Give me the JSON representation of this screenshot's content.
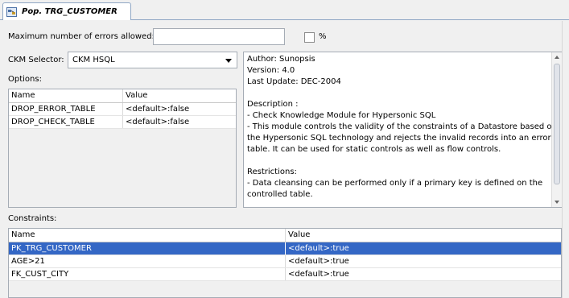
{
  "tab": {
    "title": "Pop. TRG_CUSTOMER"
  },
  "errors": {
    "label": "Maximum number of errors allowed:",
    "value": "",
    "percent_label": "%",
    "percent_checked": false
  },
  "ckm": {
    "label": "CKM Selector:",
    "selected": "CKM HSQL"
  },
  "options": {
    "label": "Options:",
    "columns": [
      "Name",
      "Value"
    ],
    "rows": [
      {
        "name": "DROP_ERROR_TABLE",
        "value": "<default>:false"
      },
      {
        "name": "DROP_CHECK_TABLE",
        "value": "<default>:false"
      }
    ]
  },
  "description": {
    "lines": [
      "Author: Sunopsis",
      "Version: 4.0",
      "Last Update: DEC-2004",
      "",
      "Description :",
      "- Check Knowledge Module for Hypersonic SQL",
      "- This module controls the validity of the constraints of a Datastore based on",
      "the Hypersonic SQL technology and rejects the invalid records into an error",
      "table. It can be used for static controls as well as flow controls.",
      "",
      "Restrictions:",
      "- Data cleansing can be performed only if a primary key is defined on the",
      "controlled table."
    ]
  },
  "constraints": {
    "label": "Constraints:",
    "columns": [
      "Name",
      "Value"
    ],
    "rows": [
      {
        "name": "PK_TRG_CUSTOMER",
        "value": "<default>:true",
        "selected": true
      },
      {
        "name": "AGE>21",
        "value": "<default>:true",
        "selected": false
      },
      {
        "name": "FK_CUST_CITY",
        "value": "<default>:true",
        "selected": false
      }
    ]
  },
  "colors": {
    "selection": "#3467c5",
    "tab_border": "#8fa6c4"
  }
}
